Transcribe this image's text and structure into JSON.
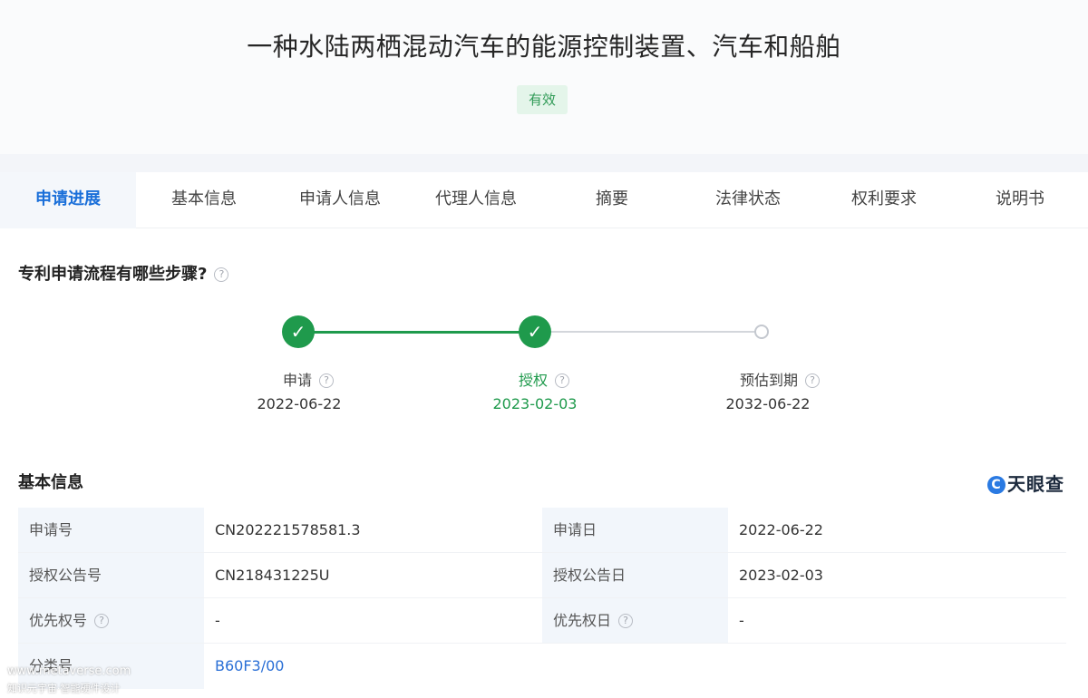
{
  "patent": {
    "title": "一种水陆两栖混动汽车的能源控制装置、汽车和船舶",
    "status": "有效"
  },
  "tabs": [
    {
      "label": "申请进展",
      "active": true
    },
    {
      "label": "基本信息"
    },
    {
      "label": "申请人信息"
    },
    {
      "label": "代理人信息"
    },
    {
      "label": "摘要"
    },
    {
      "label": "法律状态"
    },
    {
      "label": "权利要求"
    },
    {
      "label": "说明书"
    }
  ],
  "process": {
    "question": "专利申请流程有哪些步骤?",
    "help_glyph": "?",
    "check_glyph": "✓",
    "steps": [
      {
        "label": "申请",
        "date": "2022-06-22",
        "state": "done"
      },
      {
        "label": "授权",
        "date": "2023-02-03",
        "state": "done"
      },
      {
        "label": "预估到期",
        "date": "2032-06-22",
        "state": "pending"
      }
    ]
  },
  "basic_info": {
    "title": "基本信息",
    "brand": "天眼查",
    "brand_logo_glyph": "C",
    "rows": [
      {
        "k1": "申请号",
        "v1": "CN202221578581.3",
        "k2": "申请日",
        "v2": "2022-06-22"
      },
      {
        "k1": "授权公告号",
        "v1": "CN218431225U",
        "k2": "授权公告日",
        "v2": "2023-02-03"
      },
      {
        "k1": "优先权号",
        "v1": "-",
        "k2": "优先权日",
        "v2": "-"
      },
      {
        "k1": "分类号",
        "v1": "B60F3/00",
        "k2": "",
        "v2": ""
      }
    ]
  },
  "watermark": {
    "line1": "www.metaverse.com",
    "line2": "知识元宇宙·智能硬件设计"
  },
  "colors": {
    "accent": "#1a6fd9",
    "done": "#1f9a4c",
    "pending": "#c4c8cf"
  }
}
